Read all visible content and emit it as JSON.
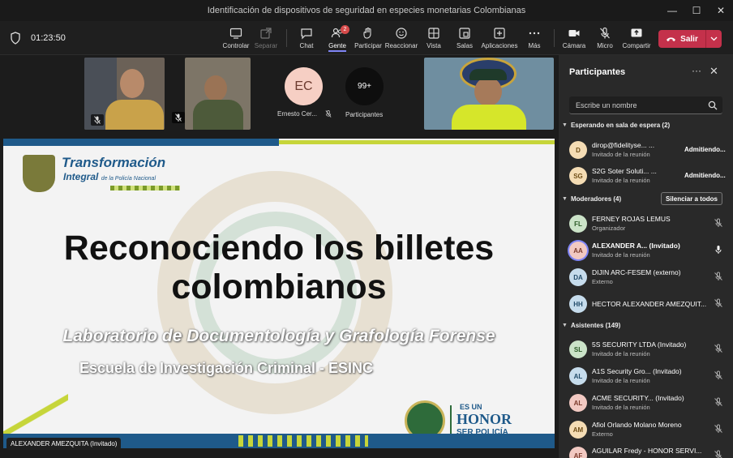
{
  "window": {
    "title": "Identificación de dispositivos de seguridad en especies monetarias Colombianas",
    "min": "—",
    "max": "☐",
    "close": "✕"
  },
  "toolbar": {
    "timer": "01:23:50",
    "buttons": {
      "controlar": "Controlar",
      "separar": "Separar",
      "chat": "Chat",
      "gente": "Gente",
      "gente_badge": "2",
      "participar": "Participar",
      "reaccionar": "Reaccionar",
      "vista": "Vista",
      "salas": "Salas",
      "aplicaciones": "Aplicaciones",
      "mas": "Más",
      "camara": "Cámara",
      "micro": "Micro",
      "compartir": "Compartir"
    },
    "leave_label": "Salir",
    "colors": {
      "leave": "#c4314b",
      "accent": "#7f85f5"
    }
  },
  "stage": {
    "tile_initials": "EC",
    "tile_name": "Ernesto Cer...",
    "more_count": "99+",
    "more_label": "Participantes",
    "presenter": "ALEXANDER AMEZQUITA (Invitado)"
  },
  "slide": {
    "logo_line1": "Transformación",
    "logo_line2": "Integral",
    "logo_line2b": "de la Policía Nacional",
    "title_line1": "Reconociendo los billetes",
    "title_line2": "colombianos",
    "subtitle1": "Laboratorio de Documentología y Grafología Forense",
    "subtitle2": "Escuela de Investigación Criminal - ESINC",
    "honor_top": "ES UN",
    "honor_mid": "HONOR",
    "honor_bot": "SER POLICÍA"
  },
  "panel": {
    "title": "Participantes",
    "search_placeholder": "Escribe un nombre",
    "sections": {
      "waiting": "Esperando en sala de espera (2)",
      "moderators": "Moderadores (4)",
      "attendees": "Asistentes (149)"
    },
    "mute_all": "Silenciar a todos",
    "waiting": [
      {
        "initials": "D",
        "name": "dirop@fidelityse... ...",
        "role": "Invitado de la reunión",
        "action": "Admitiendo..."
      },
      {
        "initials": "SG",
        "name": "S2G Soter Soluti... ...",
        "role": "Invitado de la reunión",
        "action": "Admitiendo..."
      }
    ],
    "moderators": [
      {
        "initials": "FL",
        "name": "FERNEY ROJAS LEMUS",
        "role": "Organizador"
      },
      {
        "initials": "AA",
        "name": "ALEXANDER A... (Invitado)",
        "role": "Invitado de la reunión"
      },
      {
        "initials": "DA",
        "name": "DIJIN ARC-FESEM (externo)",
        "role": "Externo"
      },
      {
        "initials": "HH",
        "name": "HECTOR ALEXANDER AMEZQUIT...",
        "role": ""
      }
    ],
    "attendees": [
      {
        "initials": "SL",
        "name": "5S SECURITY LTDA (Invitado)",
        "role": "Invitado de la reunión"
      },
      {
        "initials": "AL",
        "name": "A1S Security Gro... (Invitado)",
        "role": "Invitado de la reunión"
      },
      {
        "initials": "AL",
        "name": "ACME SECURITY... (Invitado)",
        "role": "Invitado de la reunión"
      },
      {
        "initials": "AM",
        "name": "Afiol Orlando Molano Moreno",
        "role": "Externo"
      },
      {
        "initials": "AF",
        "name": "AGUILAR Fredy - HONOR SERVI...",
        "role": ""
      }
    ]
  }
}
